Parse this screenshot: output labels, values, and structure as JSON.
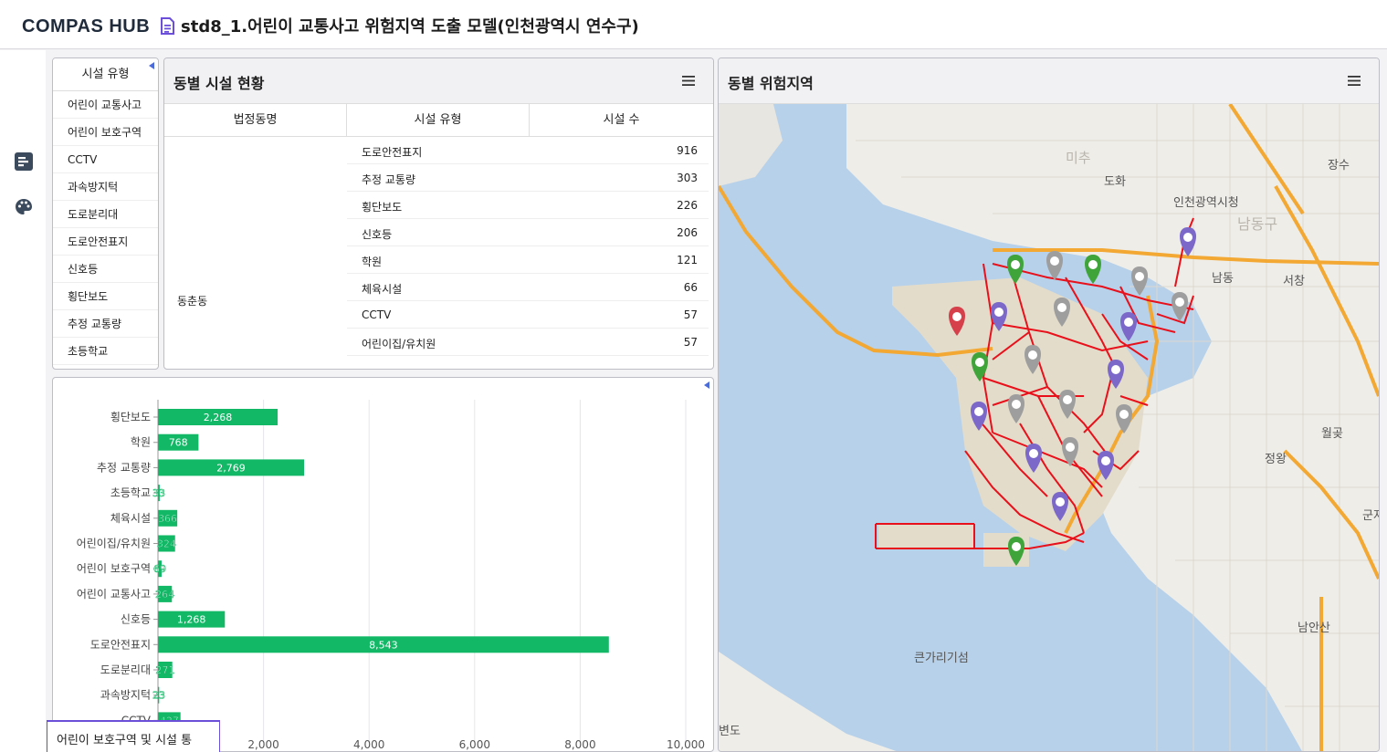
{
  "header": {
    "logo_text": "COMPAS HUB",
    "title": "std8_1.어린이 교통사고 위험지역 도출 모델(인천광역시 연수구)"
  },
  "rail": {
    "icons": [
      "report-icon",
      "palette-icon"
    ]
  },
  "filter": {
    "header": "시설 유형",
    "items": [
      "어린이 교통사고",
      "어린이 보호구역",
      "CCTV",
      "과속방지턱",
      "도로분리대",
      "도로안전표지",
      "신호등",
      "횡단보도",
      "추정 교통량",
      "초등학교"
    ]
  },
  "status": {
    "title": "동별 시설 현황",
    "columns": [
      "법정동명",
      "시설 유형",
      "시설 수"
    ],
    "dong": "동춘동",
    "rows": [
      {
        "type": "도로안전표지",
        "count": "916"
      },
      {
        "type": "추정 교통량",
        "count": "303"
      },
      {
        "type": "횡단보도",
        "count": "226"
      },
      {
        "type": "신호등",
        "count": "206"
      },
      {
        "type": "학원",
        "count": "121"
      },
      {
        "type": "체육시설",
        "count": "66"
      },
      {
        "type": "CCTV",
        "count": "57"
      },
      {
        "type": "어린이집/유치원",
        "count": "57"
      }
    ]
  },
  "chart_data": {
    "type": "bar",
    "orientation": "horizontal",
    "categories": [
      "횡단보도",
      "학원",
      "추정 교통량",
      "초등학교",
      "체육시설",
      "어린이집/유치원",
      "어린이 보호구역",
      "어린이 교통사고",
      "신호등",
      "도로안전표지",
      "도로분리대",
      "과속방지턱",
      "CCTV"
    ],
    "values": [
      2268,
      768,
      2769,
      33,
      366,
      324,
      69,
      264,
      1268,
      8543,
      271,
      23,
      427
    ],
    "value_labels": [
      "2,268",
      "768",
      "2,769",
      "33",
      "366",
      "324",
      "69",
      "264",
      "1,268",
      "8,543",
      "271",
      "23",
      "427"
    ],
    "xlim": [
      0,
      10000
    ],
    "x_ticks": [
      "2,000",
      "4,000",
      "6,000",
      "8,000",
      "10,000"
    ],
    "x_tick_values": [
      2000,
      4000,
      6000,
      8000,
      10000
    ],
    "grid": true,
    "bar_color": "#12b866"
  },
  "chart_tab": {
    "label": "어린이 보호구역 및 시설 통"
  },
  "map": {
    "title": "동별 위험지역",
    "labels": {
      "l1": "도화",
      "l2": "인천광역시청",
      "l3": "남동구",
      "l4": "남동",
      "l5": "서창",
      "l6": "장수",
      "l7": "월곶",
      "l8": "정왕",
      "l9": "남안산",
      "l10": "큰가리기섬",
      "l11": "변도",
      "l12": "미추",
      "l13": "군자"
    },
    "colors": {
      "water": "#b7d1ea",
      "land": "#efede8",
      "highway": "#f2a833",
      "risk_road": "#e8101a",
      "pin_gray": "#9e9e9e",
      "pin_purple": "#7b68c8",
      "pin_green": "#3fa43a",
      "pin_red": "#d6404a"
    }
  }
}
